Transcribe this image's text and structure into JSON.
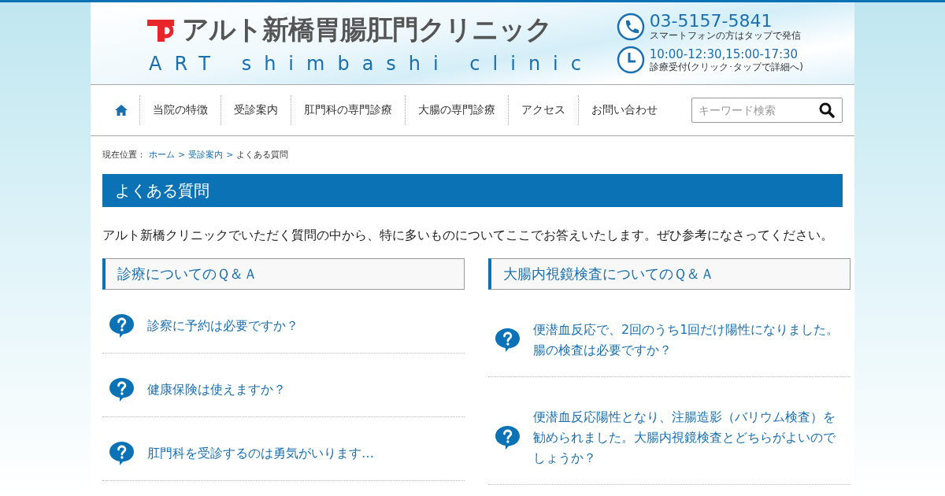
{
  "header": {
    "logo_title": "アルト新橋胃腸肛門クリニック",
    "logo_subtitle": "ART shimbashi clinic",
    "phone": "03-5157-5841",
    "phone_note": "スマートフォンの方はタップで発信",
    "hours": "10:00-12:30,15:00-17:30",
    "hours_note": "診療受付(クリック･タップで詳細へ)"
  },
  "nav": {
    "items": [
      {
        "label": "当院の特徴"
      },
      {
        "label": "受診案内"
      },
      {
        "label": "肛門科の専門診療"
      },
      {
        "label": "大腸の専門診療"
      },
      {
        "label": "アクセス"
      },
      {
        "label": "お問い合わせ"
      }
    ],
    "search_placeholder": "キーワード検索"
  },
  "breadcrumb": {
    "prefix": "現在位置：",
    "links": [
      "ホーム",
      "受診案内"
    ],
    "separator": ">",
    "current": "よくある質問"
  },
  "page_title": "よくある質問",
  "intro": "アルト新橋クリニックでいただく質問の中から、特に多いものについてここでお答えいたします。ぜひ参考になさってください。",
  "sections": [
    {
      "heading": "診療についてのＱ＆Ａ",
      "questions": [
        "診察に予約は必要ですか？",
        "健康保険は使えますか？",
        "肛門科を受診するのは勇気がいります…"
      ]
    },
    {
      "heading": "大腸内視鏡検査についてのＱ＆Ａ",
      "questions": [
        "便潜血反応で、2回のうち1回だけ陽性になりました。腸の検査は必要ですか？",
        "便潜血反応陽性となり、注腸造影（バリウム検査）を勧められました。大腸内視鏡検査とどちらがよいのでしょうか？"
      ]
    }
  ]
}
